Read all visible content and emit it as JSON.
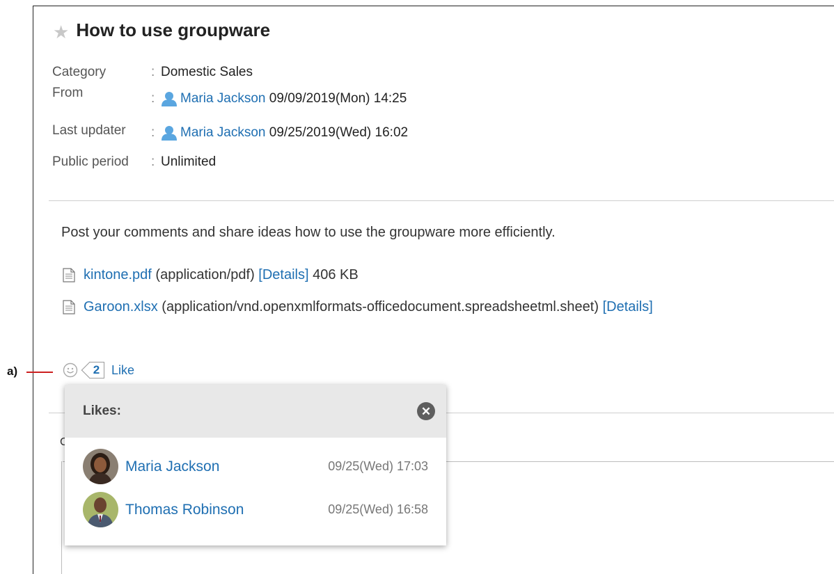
{
  "post": {
    "title": "How to use groupware",
    "meta": [
      {
        "label": "Category",
        "value": "Domestic Sales"
      },
      {
        "label": "From",
        "user": "Maria Jackson",
        "value": "09/09/2019(Mon) 14:25"
      },
      {
        "label": "Last updater",
        "user": "Maria Jackson",
        "value": "09/25/2019(Wed) 16:02"
      },
      {
        "label": "Public period",
        "value": "Unlimited"
      }
    ],
    "colon": ":",
    "body": "Post your comments and share ideas how to use the groupware more efficiently.",
    "files": [
      {
        "name": "kintone.pdf",
        "type": "(application/pdf)",
        "details": "[Details]",
        "size": "406 KB"
      },
      {
        "name": "Garoon.xlsx",
        "type": "(application/vnd.openxmlformats-officedocument.spreadsheetml.sheet)",
        "details": "[Details]"
      }
    ]
  },
  "annotation": {
    "label": "a)"
  },
  "likes": {
    "count": "2",
    "like_label": "Like",
    "popup_title": "Likes:",
    "people": [
      {
        "name": "Maria Jackson",
        "time": "09/25(Wed) 17:03"
      },
      {
        "name": "Thomas Robinson",
        "time": "09/25(Wed) 16:58"
      }
    ]
  },
  "background": {
    "partial_char": "C"
  },
  "icons": {
    "star": "star-icon",
    "user": "user-icon",
    "file": "file-icon",
    "like": "smile-icon",
    "close": "close-icon"
  },
  "colors": {
    "link": "#1f6fb2",
    "annotation_line": "#cc1f1f",
    "popup_header": "#e8e8e8"
  }
}
